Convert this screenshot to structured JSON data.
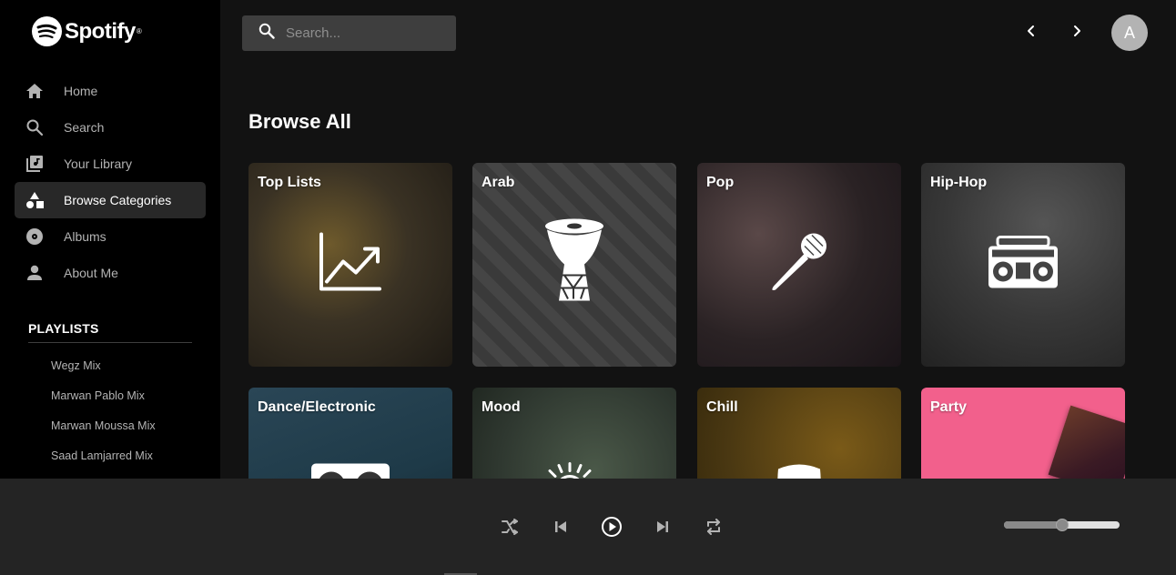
{
  "app": {
    "name": "Spotify"
  },
  "sidebar": {
    "nav": [
      {
        "label": "Home",
        "icon": "home-icon"
      },
      {
        "label": "Search",
        "icon": "search-icon"
      },
      {
        "label": "Your Library",
        "icon": "library-icon"
      },
      {
        "label": "Browse Categories",
        "icon": "shapes-icon",
        "active": true
      },
      {
        "label": "Albums",
        "icon": "disc-icon"
      },
      {
        "label": "About Me",
        "icon": "person-icon"
      }
    ],
    "playlists_title": "PLAYLISTS",
    "playlists": [
      "Wegz Mix",
      "Marwan Pablo Mix",
      "Marwan Moussa Mix",
      "Saad Lamjarred Mix"
    ]
  },
  "header": {
    "search_placeholder": "Search...",
    "avatar_initial": "A"
  },
  "main": {
    "title": "Browse All",
    "categories": [
      {
        "label": "Top Lists",
        "icon": "trending-up-icon",
        "color": "#3a3224"
      },
      {
        "label": "Arab",
        "icon": "darbuka-drum-icon",
        "color": "#4a4a4a"
      },
      {
        "label": "Pop",
        "icon": "microphone-icon",
        "color": "#2a2224"
      },
      {
        "label": "Hip-Hop",
        "icon": "boombox-icon",
        "color": "#383838"
      },
      {
        "label": "Dance/Electronic",
        "icon": "turntables-icon",
        "color": "#1e3a48"
      },
      {
        "label": "Mood",
        "icon": "sun-cloud-icon",
        "color": "#2f3830"
      },
      {
        "label": "Chill",
        "icon": "armchair-icon",
        "color": "#4a3812"
      },
      {
        "label": "Party",
        "icon": "album-art-icon",
        "color": "#f2608c"
      }
    ]
  },
  "player": {
    "volume": 0.5,
    "controls": [
      "shuffle",
      "previous",
      "play",
      "next",
      "repeat"
    ]
  },
  "colors": {
    "sidebar_bg": "#000000",
    "main_bg": "#121212",
    "player_bg": "#242424",
    "active_nav_bg": "#282828",
    "party_pink": "#f2608c"
  }
}
